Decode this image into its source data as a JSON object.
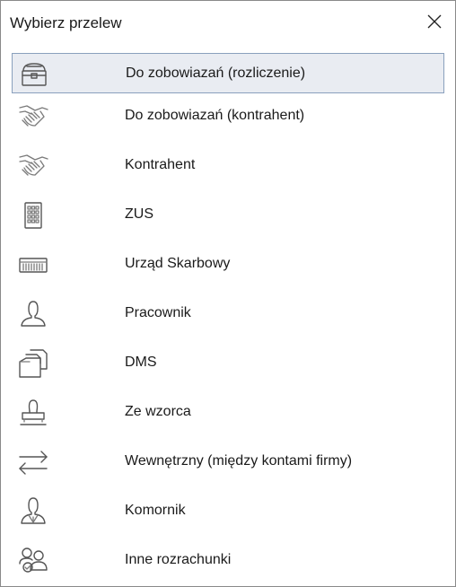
{
  "dialog": {
    "title": "Wybierz przelew",
    "close_label": "✕"
  },
  "items": [
    {
      "label": "Do zobowiazań (rozliczenie)",
      "icon": "chest-icon",
      "selected": true
    },
    {
      "label": "Do zobowiazań (kontrahent)",
      "icon": "handshake-icon",
      "selected": false
    },
    {
      "label": "Kontrahent",
      "icon": "handshake-icon",
      "selected": false
    },
    {
      "label": "ZUS",
      "icon": "building-icon",
      "selected": false
    },
    {
      "label": "Urząd Skarbowy",
      "icon": "office-icon",
      "selected": false
    },
    {
      "label": "Pracownik",
      "icon": "person-icon",
      "selected": false
    },
    {
      "label": "DMS",
      "icon": "documents-icon",
      "selected": false
    },
    {
      "label": "Ze wzorca",
      "icon": "stamp-icon",
      "selected": false
    },
    {
      "label": "Wewnętrzny (między kontami firmy)",
      "icon": "transfer-arrows-icon",
      "selected": false
    },
    {
      "label": "Komornik",
      "icon": "bailiff-icon",
      "selected": false
    },
    {
      "label": "Inne rozrachunki",
      "icon": "group-icon",
      "selected": false
    }
  ]
}
